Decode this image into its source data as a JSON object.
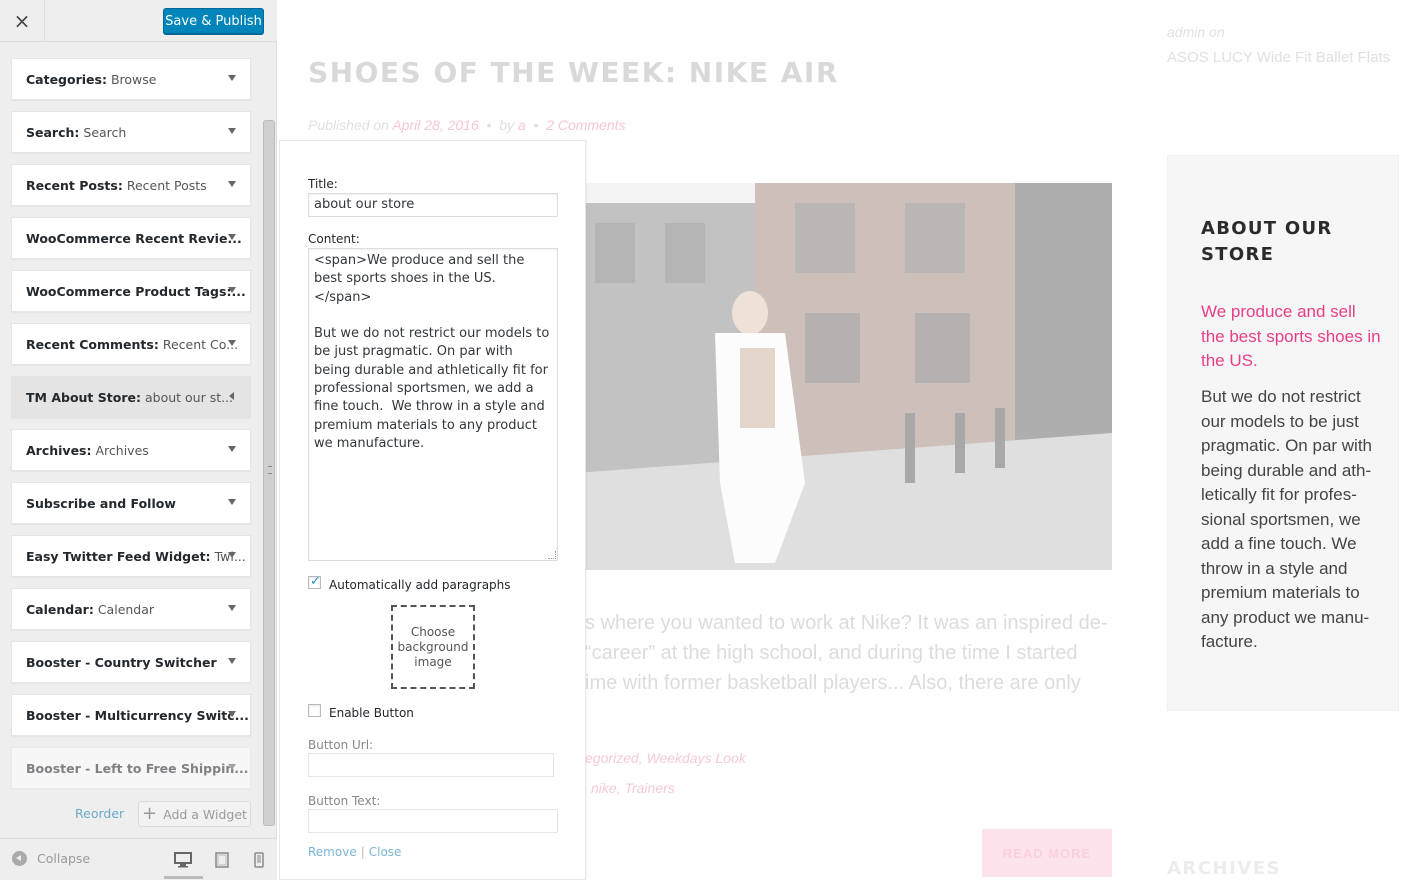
{
  "header": {
    "close_label": "×",
    "publish_label": "Save & Publish"
  },
  "widgets": [
    {
      "name": "Categories:",
      "sub": "Browse"
    },
    {
      "name": "Search:",
      "sub": "Search"
    },
    {
      "name": "Recent Posts:",
      "sub": "Recent Posts"
    },
    {
      "name": "WooCommerce Recent Revie...",
      "sub": ""
    },
    {
      "name": "WooCommerce Product Tags:...",
      "sub": ""
    },
    {
      "name": "Recent Comments:",
      "sub": "Recent Co..."
    },
    {
      "name": "TM About Store:",
      "sub": "about our st..."
    },
    {
      "name": "Archives:",
      "sub": "Archives"
    },
    {
      "name": "Subscribe and Follow",
      "sub": ""
    },
    {
      "name": "Easy Twitter Feed Widget:",
      "sub": "Twi..."
    },
    {
      "name": "Calendar:",
      "sub": "Calendar"
    },
    {
      "name": "Booster - Country Switcher",
      "sub": ""
    },
    {
      "name": "Booster - Multicurrency Switc...",
      "sub": ""
    },
    {
      "name": "Booster - Left to Free Shippin...",
      "sub": ""
    }
  ],
  "footer": {
    "reorder_label": "Reorder",
    "add_widget_label": "Add a Widget",
    "collapse_label": "Collapse"
  },
  "form": {
    "title_label": "Title:",
    "title_value": "about our store",
    "content_label": "Content:",
    "content_value": "<span>We produce and sell the best sports shoes in the US. </span>\n\nBut we do not restrict our models to be just pragmatic. On par with being durable and athletically fit for professional sportsmen, we add a fine touch.  We throw in a style and premium materials to any product we manufacture.",
    "autop_label": "Automatically add paragraphs",
    "autop_checked": true,
    "bg_image_label": "Choose background image",
    "enable_button_label": "Enable Button",
    "button_url_label": "Button Url:",
    "button_text_label": "Button Text:",
    "remove_label": "Remove",
    "sep": "|",
    "close_label": "Close"
  },
  "preview": {
    "post_title": "SHOES OF THE WEEK: NIKE AIR",
    "meta_published": "Published on",
    "meta_date": "April 28, 2016",
    "meta_by": "by",
    "meta_author": "a",
    "meta_comments": "2 Comments",
    "excerpt_lines": [
      "s where you wanted to work at Nike? It was an inspired de-",
      "“career” at the high school, and during the time I started",
      "ime with former basketball players... Also, there are only"
    ],
    "tags_line": "egorized, Weekdays Look",
    "trainers_line": "nike, Trainers",
    "read_more": "READ MORE",
    "top_meta_author": "admin",
    "top_meta_on": "on",
    "top_product": "ASOS LUCY Wide Fit Ballet Flats",
    "about_title": "ABOUT OUR STORE",
    "about_highlight": "We produce and sell the best sports shoes in the US.",
    "about_body": "But we do not restrict our models to be just pragmatic. On par with being durable and ath- letically fit for profes- sional sportsmen, we add a fine touch. We throw in a style and premium materials to any product we manu- facture.",
    "archives_title": "ARCHIVES"
  },
  "colors": {
    "accent": "#0085ba",
    "pink": "#e63e87"
  }
}
